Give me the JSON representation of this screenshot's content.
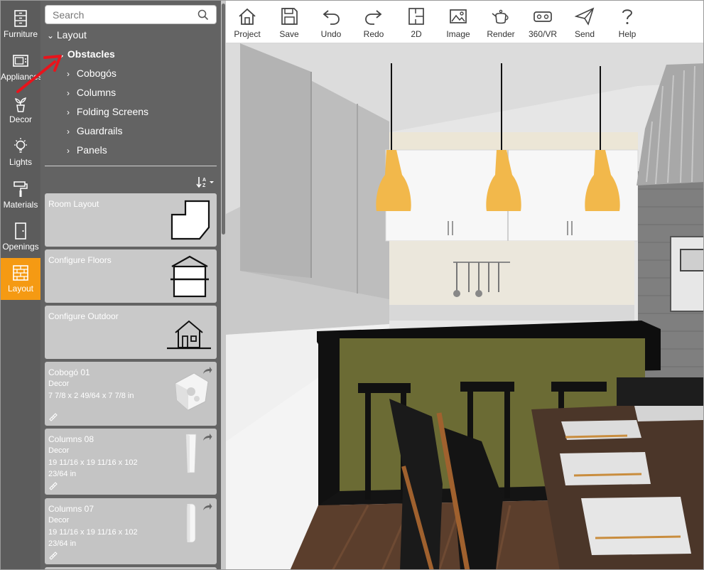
{
  "rail": {
    "items": [
      {
        "label": "Furniture",
        "icon": "furniture-icon"
      },
      {
        "label": "Appliances",
        "icon": "appliance-icon"
      },
      {
        "label": "Decor",
        "icon": "decor-plant-icon"
      },
      {
        "label": "Lights",
        "icon": "lightbulb-icon"
      },
      {
        "label": "Materials",
        "icon": "paint-roller-icon"
      },
      {
        "label": "Openings",
        "icon": "door-icon"
      },
      {
        "label": "Layout",
        "icon": "brick-wall-icon"
      }
    ],
    "active_label": "Layout",
    "active_color": "#f59a13"
  },
  "search": {
    "placeholder": "Search",
    "value": ""
  },
  "tree": {
    "layout": "Layout",
    "obstacles": "Obstacles",
    "children": [
      "Cobogós",
      "Columns",
      "Folding Screens",
      "Guardrails",
      "Panels"
    ]
  },
  "cards": [
    {
      "title": "Room Layout",
      "icon": "room-layout-icon"
    },
    {
      "title": "Configure Floors",
      "icon": "floors-house-icon"
    },
    {
      "title": "Configure Outdoor",
      "icon": "outdoor-house-icon"
    },
    {
      "title": "Cobogó 01",
      "category": "Decor",
      "dimensions": "7 7/8 x 2 49/64 x 7 7/8 in"
    },
    {
      "title": "Columns 08",
      "category": "Decor",
      "dimensions": "19 11/16 x 19 11/16 x 102 23/64 in"
    },
    {
      "title": "Columns 07",
      "category": "Decor",
      "dimensions": "19 11/16 x 19 11/16 x 102 23/64 in"
    }
  ],
  "toolbar": {
    "items": [
      {
        "label": "Project",
        "icon": "home-icon"
      },
      {
        "label": "Save",
        "icon": "floppy-disk-icon"
      },
      {
        "label": "Undo",
        "icon": "undo-icon"
      },
      {
        "label": "Redo",
        "icon": "redo-icon"
      },
      {
        "label": "2D",
        "icon": "floorplan-2d-icon"
      },
      {
        "label": "Image",
        "icon": "image-icon"
      },
      {
        "label": "Render",
        "icon": "teapot-icon"
      },
      {
        "label": "360/VR",
        "icon": "vr-headset-icon"
      },
      {
        "label": "Send",
        "icon": "paper-plane-icon"
      },
      {
        "label": "Help",
        "icon": "question-icon"
      }
    ]
  },
  "colors": {
    "rail_bg": "#5c5c5c",
    "panel_bg": "#636363",
    "card_bg": "#e3e3e3",
    "accent": "#f59a13",
    "annotation_arrow": "#e8141c"
  }
}
